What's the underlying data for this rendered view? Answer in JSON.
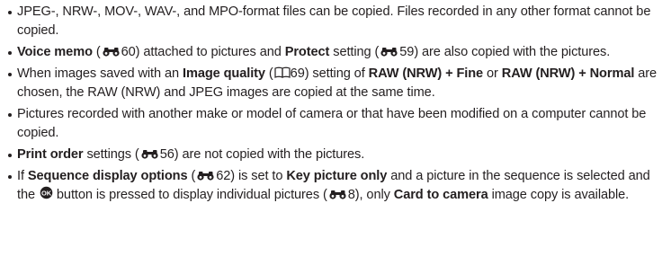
{
  "bullets": [
    {
      "a": "JPEG-, NRW-, MOV-, WAV-, and MPO-format files can be copied. Files recorded in any other format cannot be copied."
    },
    {
      "b1": "Voice memo",
      "p1": " (",
      "ref1": "60",
      "p2": ") attached to pictures and ",
      "b2": "Protect",
      "p3": " setting (",
      "ref2": "59",
      "p4": ") are also copied with the pictures."
    },
    {
      "p1": "When images saved with an ",
      "b1": "Image quality",
      "p2": " (",
      "ref1": "69",
      "p3": ") setting of ",
      "b2": "RAW (NRW) + Fine",
      "p4": " or ",
      "b3": "RAW (NRW) + Normal",
      "p5": " are chosen, the RAW (NRW) and JPEG images are copied at the same time."
    },
    {
      "a": "Pictures recorded with another make or model of camera or that have been modified on a computer cannot be copied."
    },
    {
      "b1": "Print order",
      "p1": " settings (",
      "ref1": "56",
      "p2": ") are not copied with the pictures."
    },
    {
      "p0": "If ",
      "b1": "Sequence display options",
      "p1": " (",
      "ref1": "62",
      "p2": ") is set to ",
      "b2": "Key picture only",
      "p3": " and a picture in the sequence is selected and the ",
      "p4": " button is pressed to display individual pictures (",
      "ref2": "8",
      "p5": "), only ",
      "b3": "Card to camera",
      "p6": " image copy is available."
    }
  ],
  "icons": {
    "reference_icon": "binoculars-icon",
    "book_icon": "book-icon",
    "ok_button": "ok-button-icon"
  }
}
